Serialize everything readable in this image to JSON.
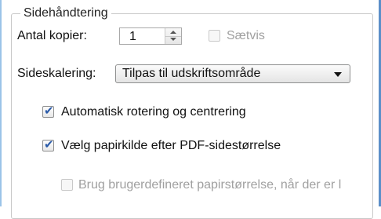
{
  "group": {
    "title": "Sidehåndtering"
  },
  "copies": {
    "label": "Antal kopier:",
    "value": "1"
  },
  "collate": {
    "label": "Sætvis",
    "checked": false,
    "enabled": false
  },
  "scaling": {
    "label": "Sideskalering:",
    "selected": "Tilpas til udskriftsområde"
  },
  "auto_rotate": {
    "label": "Automatisk rotering og centrering",
    "checked": true
  },
  "paper_source": {
    "label": "Vælg papirkilde efter PDF-sidestørrelse",
    "checked": true
  },
  "custom_paper": {
    "label": "Brug brugerdefineret papirstørrelse, når der er l",
    "checked": false,
    "enabled": false
  },
  "colors": {
    "checkmark": "#2a5aa8",
    "border_accent": "#5b8fc9",
    "disabled_text": "#a0a0a0"
  },
  "icons": {
    "spin_up": "triangle-up",
    "spin_down": "triangle-down",
    "dropdown": "chevron-down",
    "check": "checkmark"
  }
}
